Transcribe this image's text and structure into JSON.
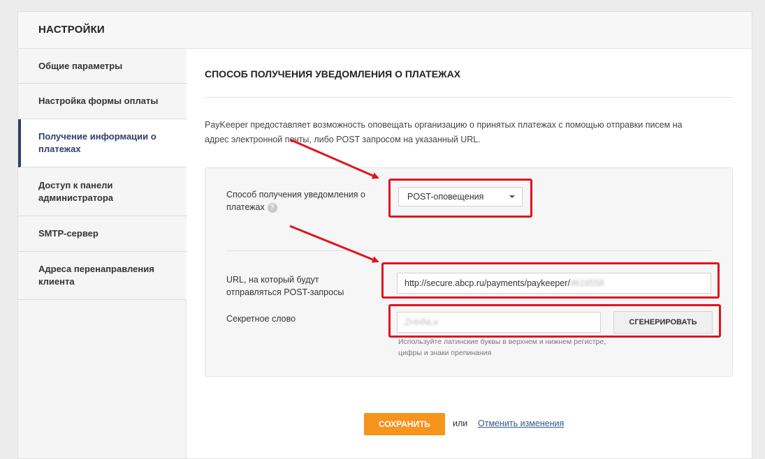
{
  "header": {
    "title": "НАСТРОЙКИ"
  },
  "sidebar": {
    "items": [
      {
        "label": "Общие параметры"
      },
      {
        "label": "Настройка формы оплаты"
      },
      {
        "label": "Получение информации о платежах"
      },
      {
        "label": "Доступ к панели администратора"
      },
      {
        "label": "SMTP-сервер"
      },
      {
        "label": "Адреса перенаправления клиента"
      }
    ],
    "active_index": 2
  },
  "main": {
    "section_title": "СПОСОБ ПОЛУЧЕНИЯ УВЕДОМЛЕНИЯ О ПЛАТЕЖАХ",
    "description": "PayKeeper предоставляет возможность оповещать организацию о принятых платежах с помощью отправки писем на адрес электронной почты, либо POST запросом на указанный URL.",
    "form": {
      "method_label": "Способ получения уведомления о платежах",
      "help_icon": "?",
      "method_value": "POST-оповещения",
      "url_label": "URL, на который будут отправляться POST-запросы",
      "url_value": "http://secure.abcp.ru/payments/paykeeper/",
      "url_value_blurred": "9616558",
      "secret_label": "Секретное слово",
      "secret_value_blurred": "ZHHNLe",
      "generate_label": "СГЕНЕРИРОВАТЬ",
      "secret_hint": "Используйте латинские буквы в верхнем и нижнем регистре, цифры и знаки препинания"
    },
    "actions": {
      "save_label": "СОХРАНИТЬ",
      "or_text": "или",
      "cancel_label": "Отменить изменения"
    }
  },
  "colors": {
    "accent_nav": "#2f3e6b",
    "save_button": "#f7941d",
    "annotation_red": "#e0141e"
  },
  "icons": [
    "help-icon",
    "chevron-down-icon",
    "arrow-annotation"
  ]
}
